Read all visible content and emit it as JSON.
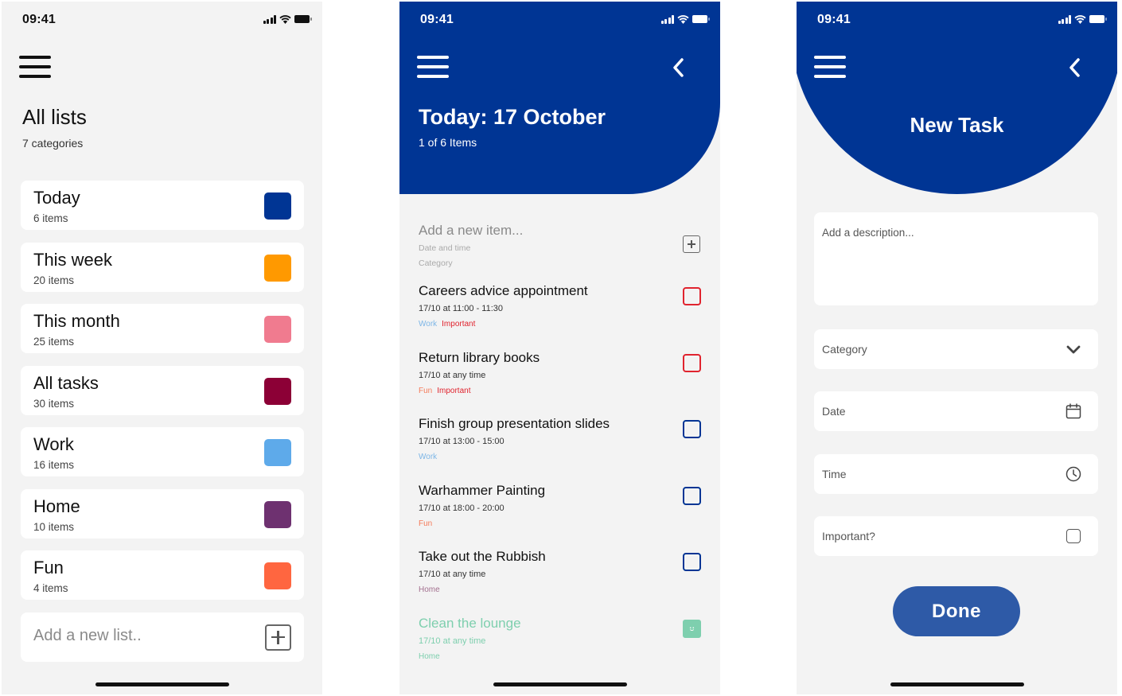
{
  "status_bar": {
    "time": "09:41"
  },
  "all_lists_screen": {
    "title": "All lists",
    "subtitle": "7 categories",
    "lists": [
      {
        "name": "Today",
        "count": "6 items",
        "color": "#003594"
      },
      {
        "name": "This week",
        "count": "20 items",
        "color": "#ff9900"
      },
      {
        "name": "This month",
        "count": "25 items",
        "color": "#f07b8f"
      },
      {
        "name": "All tasks",
        "count": "30 items",
        "color": "#8c0036"
      },
      {
        "name": "Work",
        "count": "16 items",
        "color": "#5eaaea"
      },
      {
        "name": "Home",
        "count": "10 items",
        "color": "#6e3170"
      },
      {
        "name": "Fun",
        "count": "4 items",
        "color": "#ff6640"
      }
    ],
    "add_list_placeholder": "Add a new list.."
  },
  "today_screen": {
    "title": "Today: 17 October",
    "subtitle": "1 of 6 Items",
    "add_item": {
      "placeholder": "Add a new item...",
      "date_placeholder": "Date and time",
      "category_placeholder": "Category"
    },
    "tasks": [
      {
        "title": "Careers advice appointment",
        "when": "17/10 at 11:00 - 11:30",
        "tag1": "Work",
        "tag2": "Important"
      },
      {
        "title": "Return library books",
        "when": "17/10 at any time",
        "tag1": "Fun",
        "tag2": "Important"
      },
      {
        "title": "Finish group presentation slides",
        "when": "17/10 at 13:00 - 15:00",
        "tag1": "Work",
        "tag2": ""
      },
      {
        "title": "Warhammer Painting",
        "when": "17/10 at 18:00 - 20:00",
        "tag1": "Fun",
        "tag2": ""
      },
      {
        "title": "Take out the Rubbish",
        "when": "17/10  at any time",
        "tag1": "Home",
        "tag2": ""
      },
      {
        "title": "Clean the lounge",
        "when": "17/10 at any time",
        "tag1": "Home",
        "tag2": ""
      }
    ]
  },
  "new_task_screen": {
    "title": "New Task",
    "description_placeholder": "Add a description...",
    "category_label": "Category",
    "date_label": "Date",
    "time_label": "Time",
    "important_label": "Important?",
    "done_button": "Done"
  },
  "colors": {
    "primary_blue": "#003594",
    "done_green": "#7ecfae",
    "important_red": "#e0232e",
    "done_button": "#2e5aa7"
  },
  "icons": [
    "menu-icon",
    "back-chevron-icon",
    "plus-icon",
    "chevron-down-icon",
    "calendar-icon",
    "clock-icon",
    "smile-icon",
    "signal-icon",
    "wifi-icon",
    "battery-icon"
  ]
}
